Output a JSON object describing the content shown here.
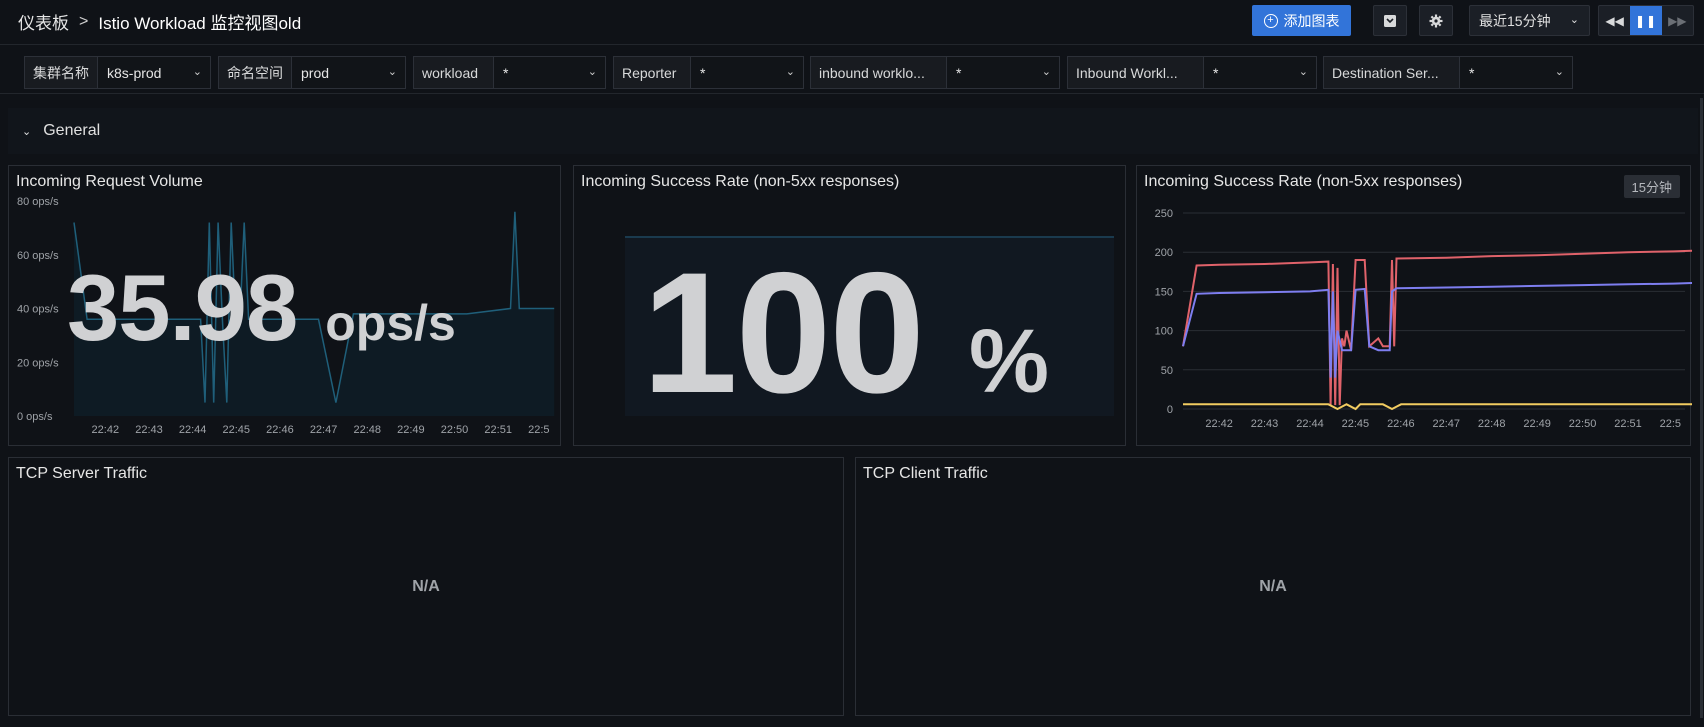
{
  "breadcrumb": {
    "root": "仪表板",
    "separator": ">",
    "title": "Istio Workload 监控视图old"
  },
  "toolbar": {
    "add_panel": "添加图表",
    "time_range": "最近15分钟"
  },
  "variables": [
    {
      "label": "集群名称",
      "value": "k8s-prod"
    },
    {
      "label": "命名空间",
      "value": "prod"
    },
    {
      "label": "workload",
      "value": "*"
    },
    {
      "label": "Reporter",
      "value": "*"
    },
    {
      "label": "inbound worklo...",
      "value": "*"
    },
    {
      "label": "Inbound Workl...",
      "value": "*"
    },
    {
      "label": "Destination Ser...",
      "value": "*"
    }
  ],
  "row": {
    "title": "General"
  },
  "panels": {
    "request_volume": {
      "title": "Incoming Request Volume",
      "value": "35.98",
      "unit": "ops/s"
    },
    "success_rate_stat": {
      "title": "Incoming Success Rate (non-5xx responses)",
      "value": "100",
      "unit": "%"
    },
    "success_rate_graph": {
      "title": "Incoming Success Rate (non-5xx responses)",
      "badge": "15分钟"
    },
    "tcp_server": {
      "title": "TCP Server Traffic",
      "empty": "N/A"
    },
    "tcp_client": {
      "title": "TCP Client Traffic",
      "empty": "N/A"
    }
  },
  "chart_data": [
    {
      "type": "line",
      "title": "Incoming Request Volume (sparkline)",
      "yticks": [
        "0 ops/s",
        "20 ops/s",
        "40 ops/s",
        "60 ops/s",
        "80 ops/s"
      ],
      "ylim": [
        0,
        80
      ],
      "xticks": [
        "22:42",
        "22:43",
        "22:44",
        "22:45",
        "22:46",
        "22:47",
        "22:48",
        "22:49",
        "22:50",
        "22:51",
        "22:5"
      ],
      "x": [
        0,
        0.3,
        0.6,
        1.0,
        1.5,
        2.0,
        2.6,
        2.9,
        3.0,
        3.1,
        3.2,
        3.3,
        3.4,
        3.5,
        3.6,
        3.7,
        3.8,
        3.9,
        4.0,
        4.3,
        4.5,
        5.0,
        5.6,
        6.0,
        6.4,
        7.0,
        8.0,
        9.0,
        10.0,
        10.1,
        10.2,
        10.3,
        10.6,
        11.0
      ],
      "values": [
        72,
        36,
        36,
        36,
        36,
        36,
        36,
        36,
        5,
        72,
        5,
        72,
        36,
        5,
        72,
        36,
        36,
        72,
        36,
        36,
        36,
        36,
        36,
        5,
        38,
        38,
        38,
        38,
        40,
        76,
        40,
        40,
        40,
        40
      ],
      "color": "#1f5f7a"
    },
    {
      "type": "line",
      "title": "Incoming Success Rate (non-5xx responses)",
      "yticks": [
        0,
        50,
        100,
        150,
        200,
        250
      ],
      "ylim": [
        0,
        250
      ],
      "xticks": [
        "22:42",
        "22:43",
        "22:44",
        "22:45",
        "22:46",
        "22:47",
        "22:48",
        "22:49",
        "22:50",
        "22:51",
        "22:5"
      ],
      "series": [
        {
          "color": "#e0626a",
          "x": [
            -0.8,
            -0.5,
            0.0,
            1.0,
            2.0,
            2.4,
            2.45,
            2.5,
            2.55,
            2.6,
            2.65,
            2.7,
            2.75,
            2.8,
            2.9,
            3.0,
            3.1,
            3.2,
            3.3,
            3.5,
            3.6,
            3.75,
            3.8,
            3.85,
            3.9,
            5.0,
            6.0,
            7.0,
            8.0,
            9.0,
            10.0,
            11.0
          ],
          "values": [
            80,
            183,
            184,
            185,
            187,
            188,
            5,
            185,
            5,
            180,
            5,
            90,
            80,
            100,
            75,
            190,
            190,
            190,
            80,
            90,
            80,
            80,
            190,
            80,
            192,
            193,
            195,
            196,
            198,
            200,
            201,
            203
          ]
        },
        {
          "color": "#7e7ef0",
          "x": [
            -0.8,
            -0.5,
            0.0,
            1.0,
            2.0,
            2.4,
            2.45,
            2.5,
            2.55,
            2.6,
            2.7,
            2.8,
            2.9,
            3.0,
            3.2,
            3.3,
            3.5,
            3.6,
            3.75,
            3.8,
            3.9,
            5.0,
            6.0,
            7.0,
            8.0,
            9.0,
            10.0,
            11.0
          ],
          "values": [
            80,
            147,
            148,
            149,
            150,
            152,
            40,
            150,
            40,
            100,
            75,
            75,
            75,
            152,
            153,
            80,
            75,
            75,
            75,
            150,
            154,
            155,
            156,
            157,
            158,
            159,
            160,
            162
          ]
        },
        {
          "color": "#f2cc61",
          "x": [
            -0.8,
            0.0,
            1.0,
            2.0,
            2.4,
            2.6,
            2.8,
            3.0,
            3.1,
            3.2,
            3.3,
            3.6,
            3.8,
            4.0,
            5.0,
            6.0,
            7.0,
            8.0,
            9.0,
            10.0,
            11.0
          ],
          "values": [
            6,
            6,
            6,
            6,
            6,
            0,
            6,
            0,
            6,
            6,
            6,
            6,
            0,
            6,
            6,
            6,
            6,
            6,
            6,
            6,
            6
          ]
        }
      ]
    }
  ]
}
